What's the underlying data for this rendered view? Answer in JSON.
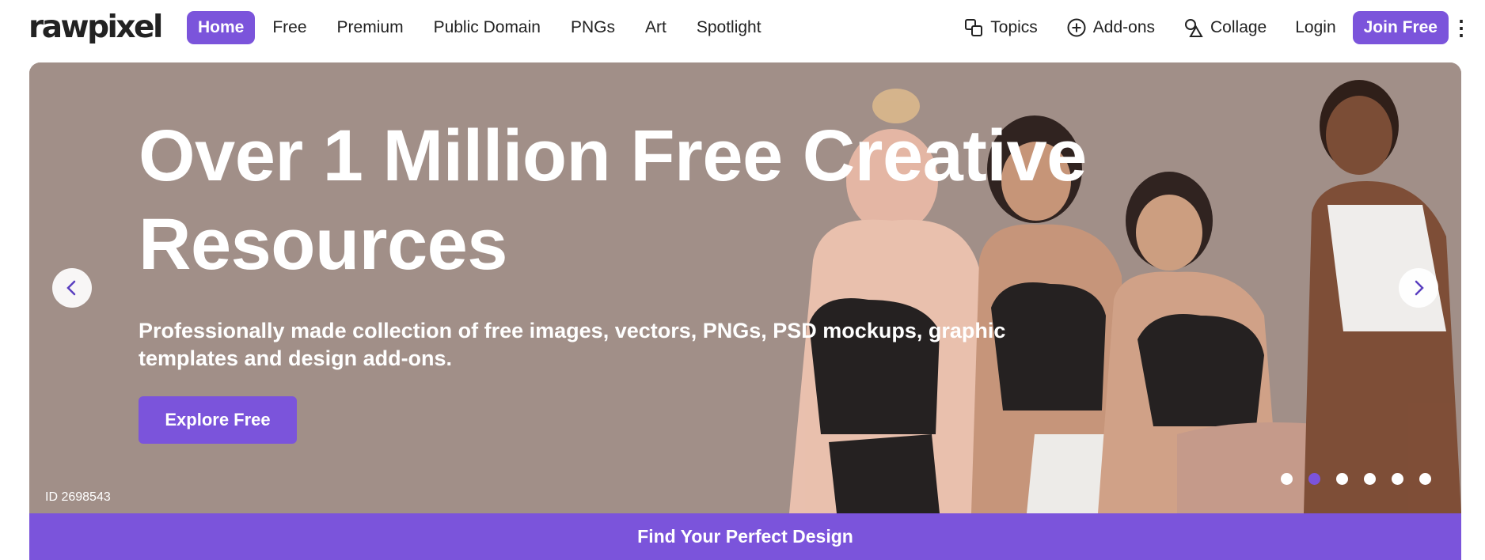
{
  "brand": {
    "logo_text": "rawpixel"
  },
  "nav": {
    "items": [
      "Home",
      "Free",
      "Premium",
      "Public Domain",
      "PNGs",
      "Art",
      "Spotlight"
    ],
    "active": "Home"
  },
  "right_nav": {
    "topics": {
      "label": "Topics",
      "icon": "topics-icon"
    },
    "addons": {
      "label": "Add-ons",
      "icon": "plus-circle-icon"
    },
    "collage": {
      "label": "Collage",
      "icon": "shapes-icon"
    },
    "login": "Login",
    "join": "Join Free",
    "more": "⋮"
  },
  "hero": {
    "title_line1": "Over 1 Million Free Creative",
    "title_line2": "Resources",
    "subtitle_line1": "Professionally made collection of free images, vectors, PNGs, PSD mockups, graphic",
    "subtitle_line2": "templates and design add-ons.",
    "cta": "Explore Free",
    "image_id": "ID 2698543",
    "slide_count": 6,
    "active_slide": 2
  },
  "find_bar": {
    "label": "Find Your Perfect Design"
  },
  "colors": {
    "accent": "#7b54db",
    "hero_bg": "#a18f88",
    "text": "#222222",
    "white": "#ffffff"
  }
}
